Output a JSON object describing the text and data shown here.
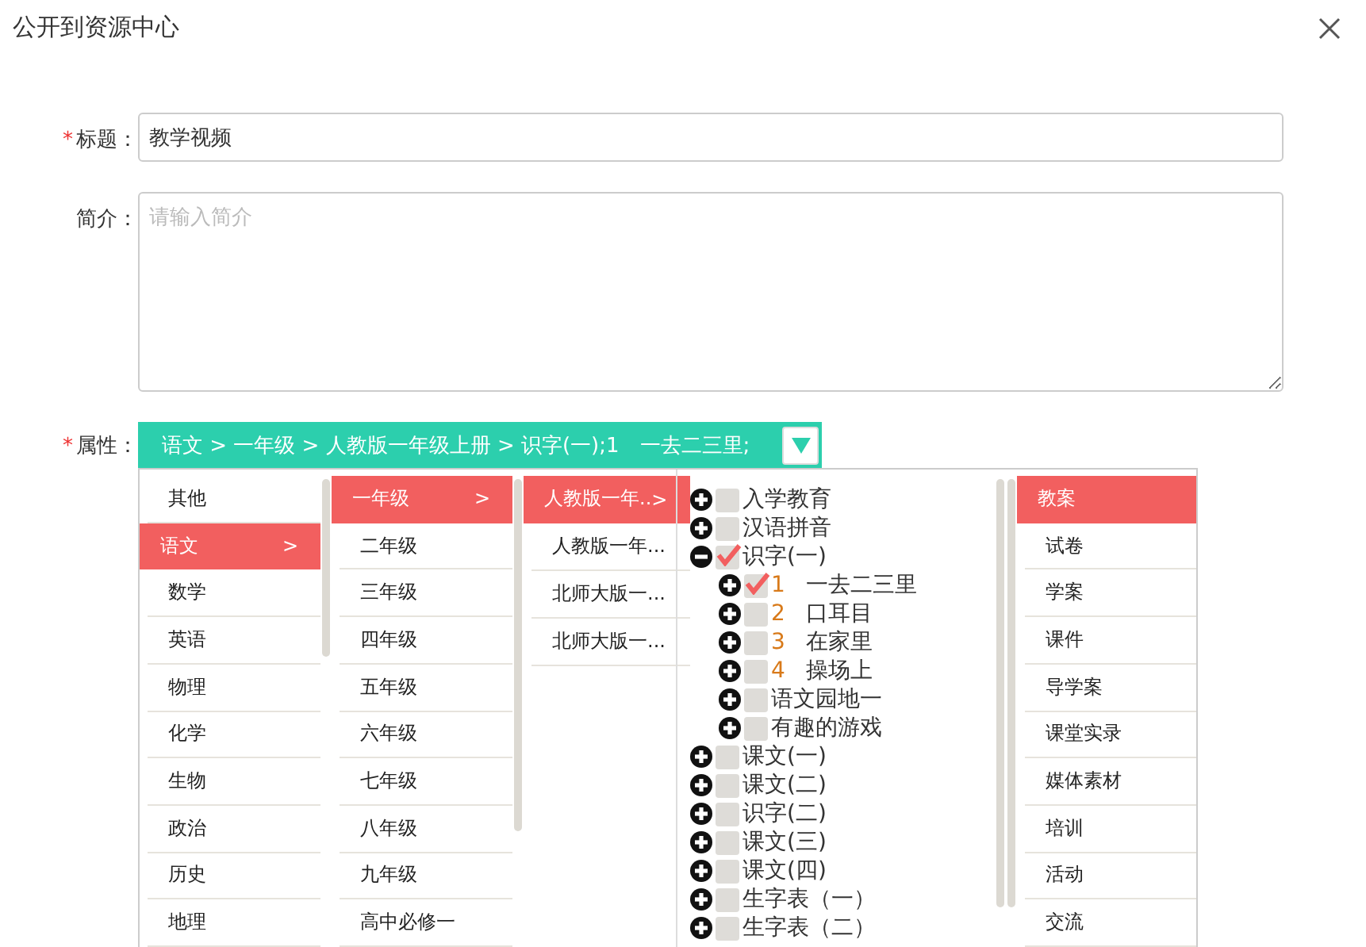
{
  "dialog": {
    "title": "公开到资源中心"
  },
  "form": {
    "title_field": {
      "marker": "*",
      "label": "标题：",
      "value": "教学视频"
    },
    "intro_field": {
      "label": "简介：",
      "placeholder": "请输入简介"
    },
    "attribute_field": {
      "marker": "*",
      "label": "属性：",
      "value": "语文 > 一年级 > 人教版一年级上册 > 识字(一);1　一去二三里;"
    }
  },
  "picker": {
    "subjects": [
      {
        "label": "其他",
        "selected": false
      },
      {
        "label": "语文",
        "selected": true,
        "suffix": ">"
      },
      {
        "label": "数学",
        "selected": false
      },
      {
        "label": "英语",
        "selected": false
      },
      {
        "label": "物理",
        "selected": false
      },
      {
        "label": "化学",
        "selected": false
      },
      {
        "label": "生物",
        "selected": false
      },
      {
        "label": "政治",
        "selected": false
      },
      {
        "label": "历史",
        "selected": false
      },
      {
        "label": "地理",
        "selected": false
      }
    ],
    "grades": [
      {
        "label": "一年级",
        "selected": true,
        "suffix": ">"
      },
      {
        "label": "二年级",
        "selected": false
      },
      {
        "label": "三年级",
        "selected": false
      },
      {
        "label": "四年级",
        "selected": false
      },
      {
        "label": "五年级",
        "selected": false
      },
      {
        "label": "六年级",
        "selected": false
      },
      {
        "label": "七年级",
        "selected": false
      },
      {
        "label": "八年级",
        "selected": false
      },
      {
        "label": "九年级",
        "selected": false
      },
      {
        "label": "高中必修一",
        "selected": false
      }
    ],
    "editions": [
      {
        "label": "人教版一年..",
        "selected": true,
        "suffix": ">"
      },
      {
        "label": "人教版一年...",
        "selected": false
      },
      {
        "label": "北师大版一...",
        "selected": false
      },
      {
        "label": "北师大版一...",
        "selected": false
      }
    ],
    "chapters": [
      {
        "label": "入学教育",
        "checked": false,
        "expanded": false
      },
      {
        "label": "汉语拼音",
        "checked": false,
        "expanded": false
      },
      {
        "label": "识字(一)",
        "checked": true,
        "expanded": true,
        "children": [
          {
            "number": "1",
            "label": "一去二三里",
            "checked": true,
            "expanded": false
          },
          {
            "number": "2",
            "label": "口耳目",
            "checked": false,
            "expanded": false
          },
          {
            "number": "3",
            "label": "在家里",
            "checked": false,
            "expanded": false
          },
          {
            "number": "4",
            "label": "操场上",
            "checked": false,
            "expanded": false
          },
          {
            "label": "语文园地一",
            "checked": false,
            "expanded": false
          },
          {
            "label": "有趣的游戏",
            "checked": false,
            "expanded": false
          }
        ]
      },
      {
        "label": "课文(一)",
        "checked": false,
        "expanded": false
      },
      {
        "label": "课文(二)",
        "checked": false,
        "expanded": false
      },
      {
        "label": "识字(二)",
        "checked": false,
        "expanded": false
      },
      {
        "label": "课文(三)",
        "checked": false,
        "expanded": false
      },
      {
        "label": "课文(四)",
        "checked": false,
        "expanded": false
      },
      {
        "label": "生字表（一）",
        "checked": false,
        "expanded": false
      },
      {
        "label": "生字表（二）",
        "checked": false,
        "expanded": false
      }
    ],
    "types": [
      {
        "label": "教案",
        "selected": true
      },
      {
        "label": "试卷",
        "selected": false
      },
      {
        "label": "学案",
        "selected": false
      },
      {
        "label": "课件",
        "selected": false
      },
      {
        "label": "导学案",
        "selected": false
      },
      {
        "label": "课堂实录",
        "selected": false
      },
      {
        "label": "媒体素材",
        "selected": false
      },
      {
        "label": "培训",
        "selected": false
      },
      {
        "label": "活动",
        "selected": false
      },
      {
        "label": "交流",
        "selected": false
      }
    ]
  }
}
